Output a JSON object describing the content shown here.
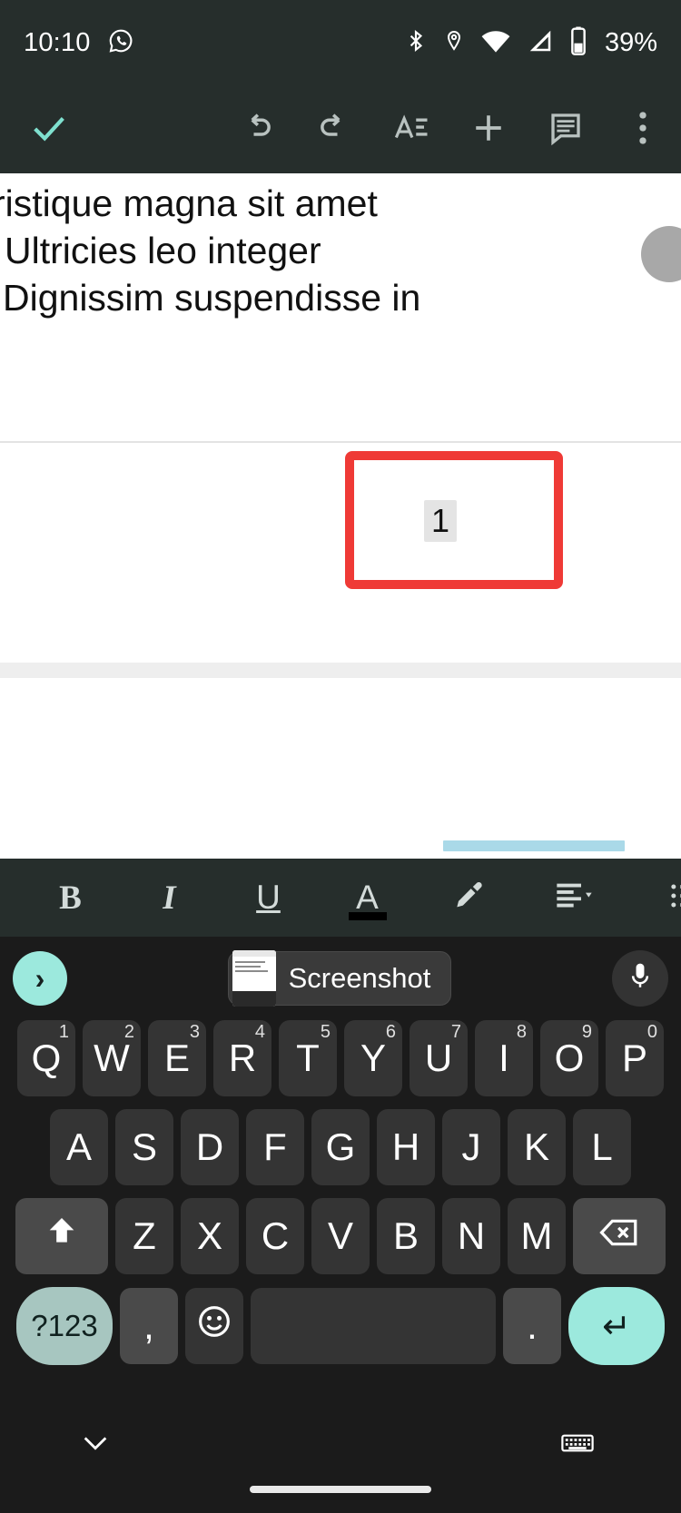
{
  "status_bar": {
    "time": "10:10",
    "battery_text": "39%",
    "icons": [
      "whatsapp-icon",
      "bluetooth-icon",
      "location-icon",
      "wifi-icon",
      "cellular-signal-icon",
      "battery-icon"
    ]
  },
  "app_toolbar": {
    "done_label": "done-checkmark",
    "buttons": [
      {
        "name": "undo-button",
        "label": "undo"
      },
      {
        "name": "redo-button",
        "label": "redo"
      },
      {
        "name": "format-button",
        "label": "format"
      },
      {
        "name": "insert-button",
        "label": "insert"
      },
      {
        "name": "comment-button",
        "label": "comment"
      },
      {
        "name": "more-options-button",
        "label": "more"
      }
    ]
  },
  "document": {
    "lines": [
      "ristique magna sit amet",
      "Ultricies leo integer",
      "Dignissim suspendisse in"
    ],
    "page_number": "1",
    "annotation_color": "#ef3a36",
    "selection_color": "#aad9e8"
  },
  "format_toolbar": {
    "bold_label": "B",
    "italic_label": "I",
    "underline_label": "U",
    "text_color_label": "A",
    "highlight_label": "highlight-pen",
    "align_label": "align",
    "list_label": "list"
  },
  "keyboard": {
    "suggestion": {
      "expand_label": "›",
      "chip_label": "Screenshot",
      "mic_label": "microphone"
    },
    "row1": [
      {
        "letter": "Q",
        "num": "1"
      },
      {
        "letter": "W",
        "num": "2"
      },
      {
        "letter": "E",
        "num": "3"
      },
      {
        "letter": "R",
        "num": "4"
      },
      {
        "letter": "T",
        "num": "5"
      },
      {
        "letter": "Y",
        "num": "6"
      },
      {
        "letter": "U",
        "num": "7"
      },
      {
        "letter": "I",
        "num": "8"
      },
      {
        "letter": "O",
        "num": "9"
      },
      {
        "letter": "P",
        "num": "0"
      }
    ],
    "row2": [
      "A",
      "S",
      "D",
      "F",
      "G",
      "H",
      "J",
      "K",
      "L"
    ],
    "row3": [
      "Z",
      "X",
      "C",
      "V",
      "B",
      "N",
      "M"
    ],
    "row4": {
      "symbols_label": "?123",
      "comma_label": ",",
      "emoji_label": "emoji",
      "space_label": "",
      "period_label": ".",
      "enter_label": "↵"
    },
    "shift_label": "shift",
    "backspace_label": "backspace",
    "hide_label": "⌄",
    "switch_label": "keyboard-switch"
  }
}
